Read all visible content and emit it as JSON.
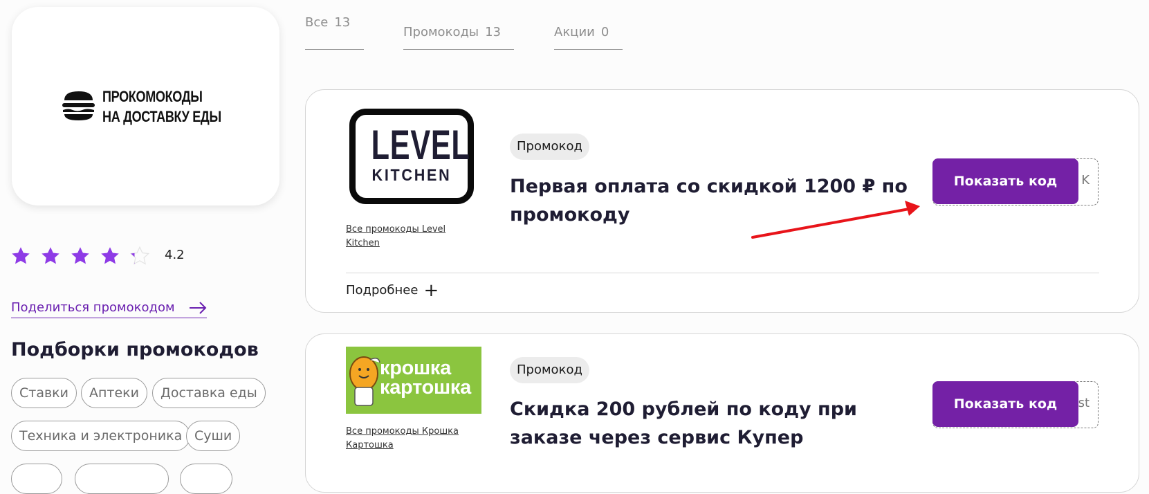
{
  "site": {
    "logo_line1": "ПРОКОМОКОДЫ",
    "logo_line2": "НА ДОСТАВКУ ЕДЫ",
    "logo_icon": "burger-icon"
  },
  "rating": {
    "value": "4.2",
    "stars_filled": 4,
    "stars_total": 5
  },
  "share_link": "Поделиться промокодом",
  "collections": {
    "title": "Подборки промокодов",
    "chips": [
      "Ставки",
      "Аптеки",
      "Доставка еды",
      "Техника и электроника",
      "Суши"
    ]
  },
  "tabs": [
    {
      "label": "Все",
      "count": "13"
    },
    {
      "label": "Промокоды",
      "count": "13"
    },
    {
      "label": "Акции",
      "count": "0"
    }
  ],
  "promos": [
    {
      "brand": "Level Kitchen",
      "logo_line1": "LEVEL",
      "logo_line2": "KITCHEN",
      "brand_link": "Все промокоды Level Kitchen",
      "badge": "Промокод",
      "title": "Первая оплата со скидкой 1200 ₽ по промокоду",
      "code_hint": "K",
      "button": "Показать код",
      "more": "Подробнее",
      "more_icon": "plus-icon"
    },
    {
      "brand": "Крошка Картошка",
      "logo_line1": "крошка",
      "logo_line2": "картошка",
      "brand_link": "Все промокоды Крошка Картошка",
      "badge": "Промокод",
      "title": "Скидка 200 рублей по коду при заказе через сервис Купер",
      "code_hint": "st",
      "button": "Показать код"
    }
  ],
  "colors": {
    "accent": "#7421a6",
    "star": "#8e3be6",
    "annotation_arrow": "#e8141a",
    "kk_green": "#8bc53f"
  }
}
